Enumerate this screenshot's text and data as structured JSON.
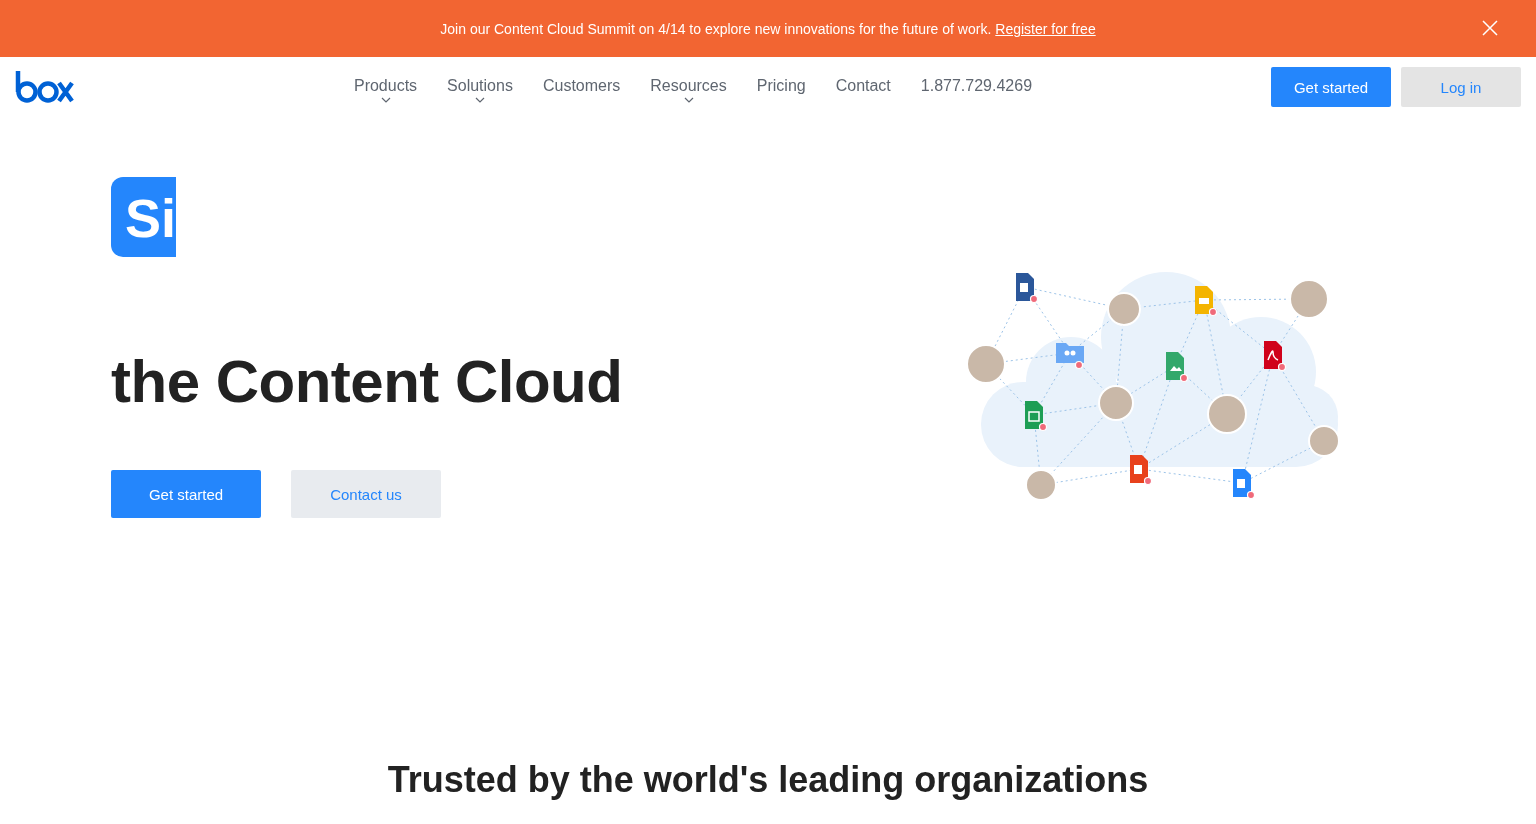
{
  "banner": {
    "text": "Join our Content Cloud Summit on 4/14 to explore new innovations for the future of work.",
    "link": "Register for free"
  },
  "nav": {
    "items": [
      {
        "label": "Products",
        "has_menu": true
      },
      {
        "label": "Solutions",
        "has_menu": true
      },
      {
        "label": "Customers",
        "has_menu": false
      },
      {
        "label": "Resources",
        "has_menu": true
      },
      {
        "label": "Pricing",
        "has_menu": false
      },
      {
        "label": "Contact",
        "has_menu": false
      },
      {
        "label": "1.877.729.4269",
        "has_menu": false
      }
    ],
    "buttons": [
      {
        "label": "Get started",
        "kind": "primary"
      },
      {
        "label": "Log in",
        "kind": "secondary"
      }
    ]
  },
  "hero": {
    "word_badge": "Si",
    "heading": "the Content Cloud",
    "buttons": [
      {
        "label": "Get started",
        "kind": "primary"
      },
      {
        "label": "Contact us",
        "kind": "secondary"
      }
    ]
  },
  "trusted": {
    "heading": "Trusted by the world's leading organizations"
  }
}
